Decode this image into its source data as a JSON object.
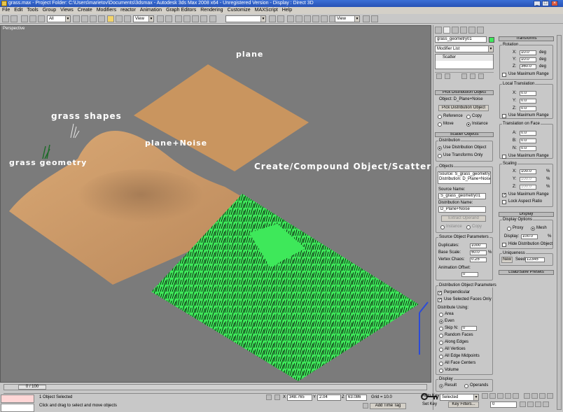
{
  "window": {
    "title": "grass.max - Project Folder: C:\\Users\\marietov\\Documents\\3dsmax - Autodesk 3ds Max 2008 x64 - Unregistered Version - Display : Direct 3D"
  },
  "menu": [
    "File",
    "Edit",
    "Tools",
    "Group",
    "Views",
    "Create",
    "Modifiers",
    "reactor",
    "Animation",
    "Graph Editors",
    "Rendering",
    "Customize",
    "MAXScript",
    "Help"
  ],
  "toolbar": {
    "selection_filter": "All",
    "ref_coord": "View",
    "named_sel": "",
    "view_combo": "View"
  },
  "viewport": {
    "label": "Perspective",
    "annotations": {
      "plane": "plane",
      "grass_shapes": "grass shapes",
      "plane_noise": "plane+Noise",
      "grass_geometry": "grass geometry",
      "scatter": "Create/Compound Object/Scatter"
    }
  },
  "command_panel": {
    "object_name": "grass_geometry01",
    "modifier_list": "Modifier List",
    "stack_item": "Scatter",
    "pick_distribution": {
      "rollout": "Pick Distribution Object",
      "object": "Object: D_Plane+Noise",
      "button": "Pick Distribution Object",
      "reference": "Reference",
      "copy": "Copy",
      "move": "Move",
      "instance": "Instance"
    },
    "scatter_objects": {
      "rollout": "Scatter Objects",
      "distribution": "Distribution",
      "use_dist": "Use Distribution Object",
      "use_transforms": "Use Transforms Only",
      "objects": "Objects",
      "list": [
        "Source: S_grass_geometry",
        "Distribution: D_Plane+Noise"
      ],
      "source_name_label": "Source Name:",
      "source_name": "S_grass_geometry01",
      "dist_name_label": "Distribution Name:",
      "dist_name": "D_Plane+Noise",
      "extract": "Extract Operand",
      "instance": "Instance",
      "copy": "Copy"
    },
    "source_params": {
      "title": "Source Object Parameters",
      "duplicates_label": "Duplicates:",
      "duplicates": "1000",
      "base_scale_label": "Base Scale:",
      "base_scale": "50.0",
      "vertex_chaos_label": "Vertex Chaos:",
      "vertex_chaos": "0.25",
      "anim_offset_label": "Animation Offset:",
      "anim_offset": "0"
    },
    "dist_params": {
      "title": "Distribution Object Parameters",
      "perpendicular": "Perpendicular",
      "use_selected": "Use Selected Faces Only",
      "dist_using": "Distribute Using:",
      "options": [
        "Area",
        "Even",
        "Skip N:",
        "Random Faces",
        "Along Edges",
        "All Vertices",
        "All Edge Midpoints",
        "All Face Centers",
        "Volume"
      ],
      "skip_n": "0"
    },
    "display": {
      "title": "Display",
      "result": "Result",
      "operands": "Operands"
    }
  },
  "transforms": {
    "rollout": "Transforms",
    "rotation": {
      "title": "Rotation",
      "x": "10.0",
      "y": "10.0",
      "z": "360.0",
      "unit": "deg",
      "use_max": "Use Maximum Range"
    },
    "local_translation": {
      "title": "Local Translation",
      "x": "0.0",
      "y": "0.0",
      "z": "0.0",
      "use_max": "Use Maximum Range"
    },
    "translation_on_face": {
      "title": "Translation on Face",
      "a": "0.0",
      "b": "0.0",
      "n": "0.0",
      "use_max": "Use Maximum Range"
    },
    "scaling": {
      "title": "Scaling",
      "x": "100.0",
      "y": "100.0",
      "z": "100.0",
      "unit": "%",
      "use_max": "Use Maximum Range",
      "lock": "Lock Aspect Ratio"
    }
  },
  "display_rollout": {
    "rollout": "Display",
    "options": "Display Options",
    "proxy": "Proxy",
    "mesh": "Mesh",
    "display_label": "Display:",
    "display_val": "100.0",
    "display_unit": "%",
    "hide": "Hide Distribution Object",
    "uniqueness": "Uniqueness",
    "new": "New",
    "seed_label": "Seed:",
    "seed": "12345",
    "load_save": "Load/Save Presets"
  },
  "status": {
    "time": "0 / 100",
    "selected": "1 Object Selected",
    "prompt": "Click and drag to select and move objects",
    "x_label": "X",
    "x": "348.765",
    "y_label": "Y",
    "y": "2.04",
    "z_label": "Z",
    "z": "63.086",
    "grid": "Grid = 10.0",
    "add_time_tag": "Add Time Tag",
    "auto_key": "Auto Key",
    "set_key": "Set Key",
    "key_mode": "Selected",
    "key_filters": "Key Filters...",
    "frame": "0"
  }
}
